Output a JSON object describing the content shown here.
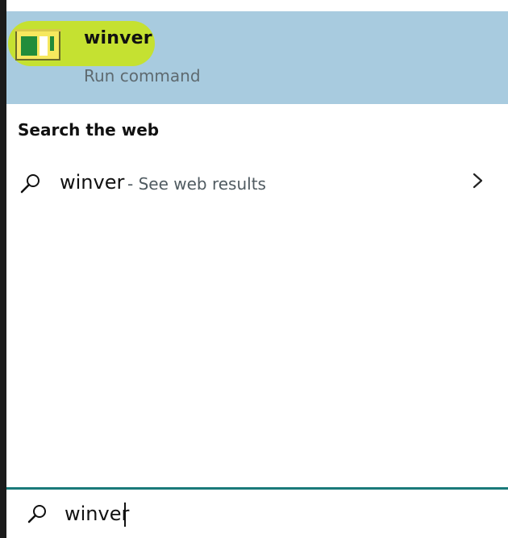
{
  "best_match": {
    "title": "winver",
    "subtitle": "Run command"
  },
  "web_section": {
    "title": "Search the web",
    "query": "winver",
    "suffix": "- See web results"
  },
  "search": {
    "value": "winver",
    "placeholder": ""
  },
  "colors": {
    "selected_bg": "#a8cbdf",
    "highlight": "#c6e227",
    "divider": "#1a7a7a"
  },
  "icons": {
    "app": "run-command-icon",
    "web_search": "search-icon",
    "chevron": "chevron-right-icon",
    "input_search": "search-icon"
  }
}
